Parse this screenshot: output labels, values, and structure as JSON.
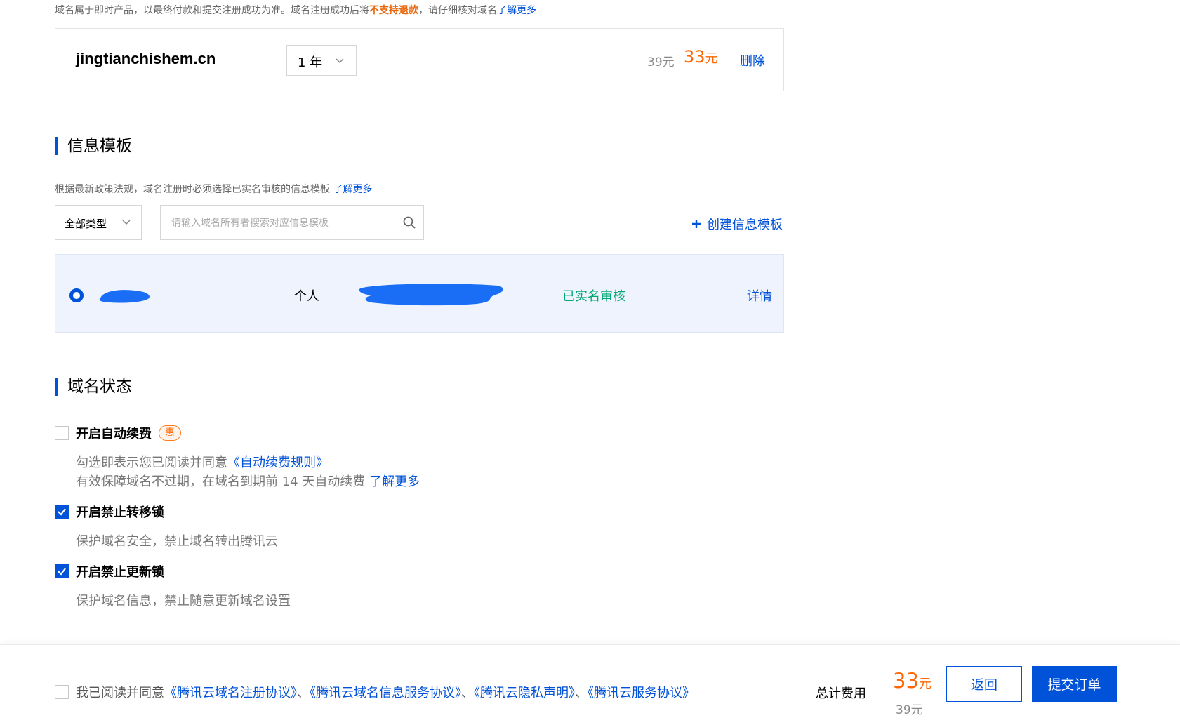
{
  "notice": {
    "prefix": "域名属于即时产品，以最终付款和提交注册成功为准。域名注册成功后将",
    "warn": "不支持退款",
    "suffix": "，请仔细核对域名",
    "link": "了解更多"
  },
  "domain": {
    "name": "jingtianchishem.cn",
    "year": "1 年",
    "original_price": "39元",
    "price": "33",
    "price_unit": "元",
    "delete_label": "删除"
  },
  "info_template": {
    "title": "信息模板",
    "hint": "根据最新政策法规，域名注册时必须选择已实名审核的信息模板",
    "hint_link": "了解更多",
    "type_filter": "全部类型",
    "search_placeholder": "请输入域名所有者搜索对应信息模板",
    "create_label": "创建信息模板",
    "row": {
      "type": "个人",
      "status": "已实名审核",
      "detail_label": "详情"
    }
  },
  "domain_status": {
    "title": "域名状态",
    "auto_renew": {
      "label": "开启自动续费",
      "badge": "惠",
      "desc1_prefix": "勾选即表示您已阅读并同意",
      "desc1_link": "《自动续费规则》",
      "desc2_prefix": "有效保障域名不过期，在域名到期前 14 天自动续费",
      "desc2_link": "了解更多"
    },
    "transfer_lock": {
      "label": "开启禁止转移锁",
      "desc": "保护域名安全，禁止域名转出腾讯云"
    },
    "update_lock": {
      "label": "开启禁止更新锁",
      "desc": "保护域名信息，禁止随意更新域名设置"
    }
  },
  "footer": {
    "agree_prefix": "我已阅读并同意",
    "agreements": [
      "《腾讯云域名注册协议》",
      "《腾讯云域名信息服务协议》",
      "《腾讯云隐私声明》",
      "《腾讯云服务协议》"
    ],
    "separator": "、",
    "total_label": "总计费用",
    "total_price": "33",
    "total_unit": "元",
    "total_original": "39元",
    "back_label": "返回",
    "submit_label": "提交订单"
  },
  "colors": {
    "accent": "#0052d9",
    "price": "#ff6600",
    "verified": "#00a870"
  }
}
